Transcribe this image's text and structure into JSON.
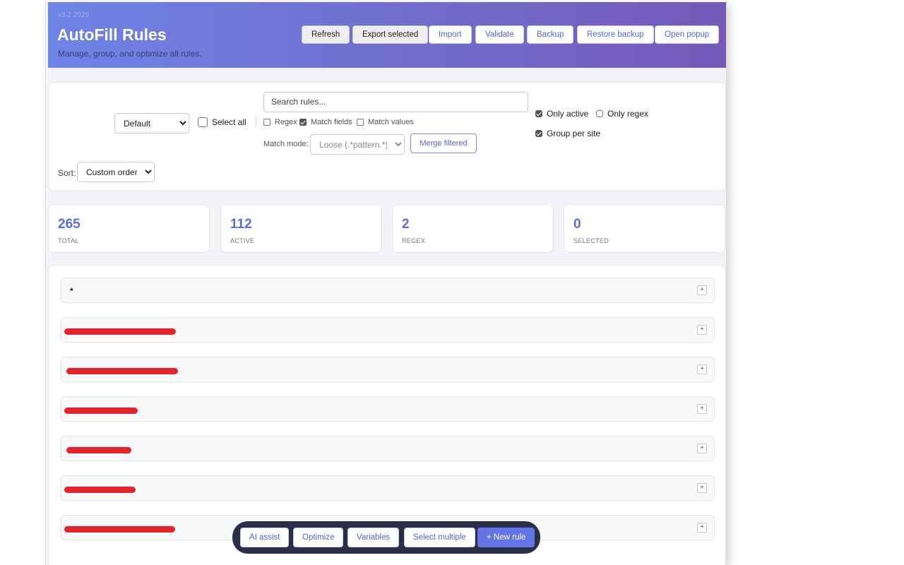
{
  "header": {
    "version": "v3.2 2025",
    "title": "AutoFill Rules",
    "subtitle": "Manage, group, and optimize all rules.",
    "buttons": [
      "Refresh",
      "Export selected",
      "Import",
      "Validate",
      "Backup",
      "Restore backup",
      "Open popup"
    ]
  },
  "filters": {
    "profile": "Default",
    "select_all": "Select all",
    "search_placeholder": "Search rules...",
    "regex": "Regex",
    "match_fields": "Match fields",
    "match_values": "Match values",
    "match_mode_label": "Match mode:",
    "match_mode": "Loose (.*pattern.*)",
    "merge": "Merge filtered",
    "only_active": "Only active",
    "only_regex": "Only regex",
    "group_per_site": "Group per site",
    "sort_label": "Sort:",
    "sort": "Custom order",
    "checks": {
      "regex": false,
      "match_fields": true,
      "match_values": false,
      "only_active": true,
      "only_regex": false,
      "group_per_site": true,
      "select_all": false
    }
  },
  "stats": [
    {
      "value": "265",
      "label": "TOTAL"
    },
    {
      "value": "112",
      "label": "ACTIVE"
    },
    {
      "value": "2",
      "label": "REGEX"
    },
    {
      "value": "0",
      "label": "SELECTED"
    }
  ],
  "groups": [
    {
      "name": "*",
      "redacted": false
    },
    {
      "name": "",
      "redacted": true
    },
    {
      "name": "",
      "redacted": true
    },
    {
      "name": "",
      "redacted": true
    },
    {
      "name": "",
      "redacted": true
    },
    {
      "name": "",
      "redacted": true
    },
    {
      "name": "",
      "redacted": true
    }
  ],
  "expand_symbol": "+",
  "bottom_bar": [
    "AI assist",
    "Optimize",
    "Variables",
    "Select multiple",
    "+ New rule"
  ],
  "colors": {
    "accent": "#5b6ddc",
    "header_start": "#6e84e6",
    "header_end": "#7459b8",
    "redaction": "#e8222a"
  }
}
